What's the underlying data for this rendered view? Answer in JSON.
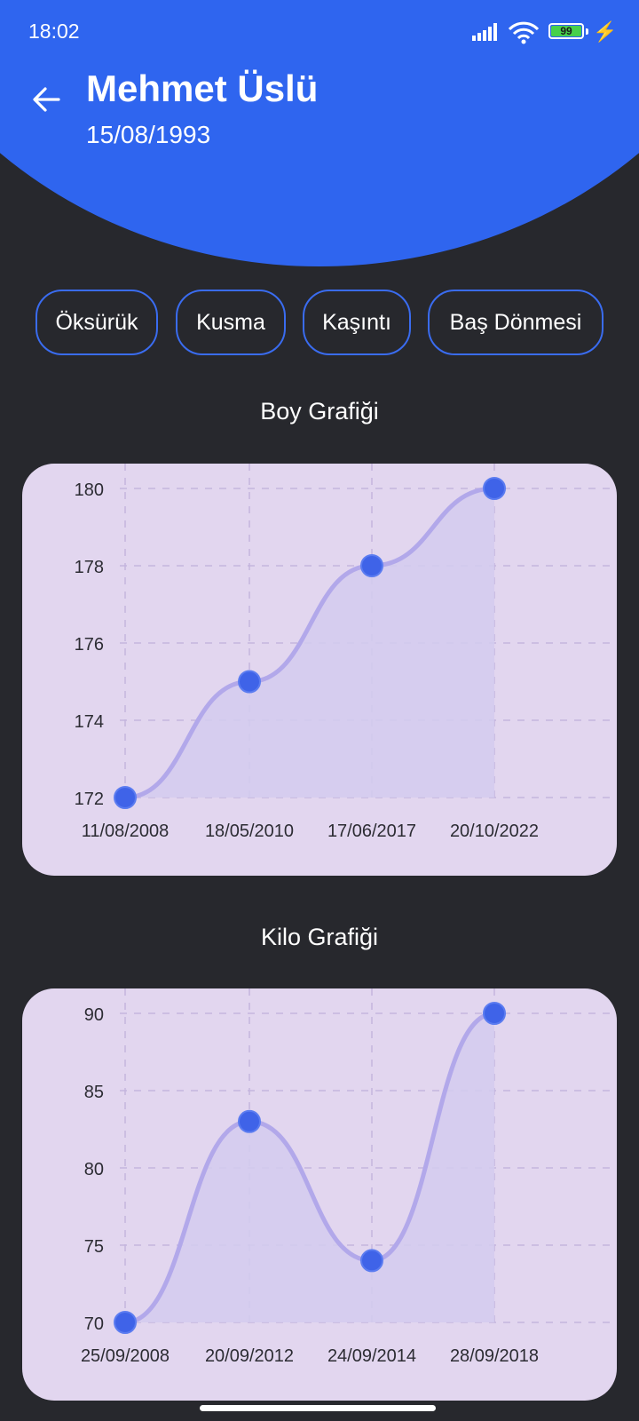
{
  "status_bar": {
    "time": "18:02",
    "battery": "99",
    "icons": [
      "signal-icon",
      "wifi-icon",
      "battery-icon",
      "charging-icon"
    ]
  },
  "header": {
    "back_icon": "arrow-left-icon",
    "name": "Mehmet Üslü",
    "dob": "15/08/1993"
  },
  "chips": [
    {
      "label": "Öksürük"
    },
    {
      "label": "Kusma"
    },
    {
      "label": "Kaşıntı"
    },
    {
      "label": "Baş Dönmesi"
    }
  ],
  "charts": {
    "height": {
      "title": "Boy Grafiği"
    },
    "weight": {
      "title": "Kilo Grafiği"
    }
  },
  "colors": {
    "header": "#2f65ef",
    "background": "#27282d",
    "card": "#e2d6ef",
    "point": "#3f63e8",
    "line": "#b2a8ea",
    "area": "#d3cbee"
  },
  "chart_data": [
    {
      "type": "line",
      "title": "Boy Grafiği",
      "x": [
        "11/08/2008",
        "18/05/2010",
        "17/06/2017",
        "20/10/2022"
      ],
      "series": [
        {
          "values": [
            172,
            175,
            178,
            180
          ]
        }
      ],
      "ylim": [
        172,
        180
      ],
      "yticks": [
        172,
        174,
        176,
        178,
        180
      ],
      "grid": true
    },
    {
      "type": "line",
      "title": "Kilo Grafiği",
      "x": [
        "25/09/2008",
        "20/09/2012",
        "24/09/2014",
        "28/09/2018"
      ],
      "series": [
        {
          "values": [
            70,
            83,
            74,
            90
          ]
        }
      ],
      "ylim": [
        70,
        90
      ],
      "yticks": [
        70,
        75,
        80,
        85,
        90
      ],
      "grid": true
    }
  ]
}
